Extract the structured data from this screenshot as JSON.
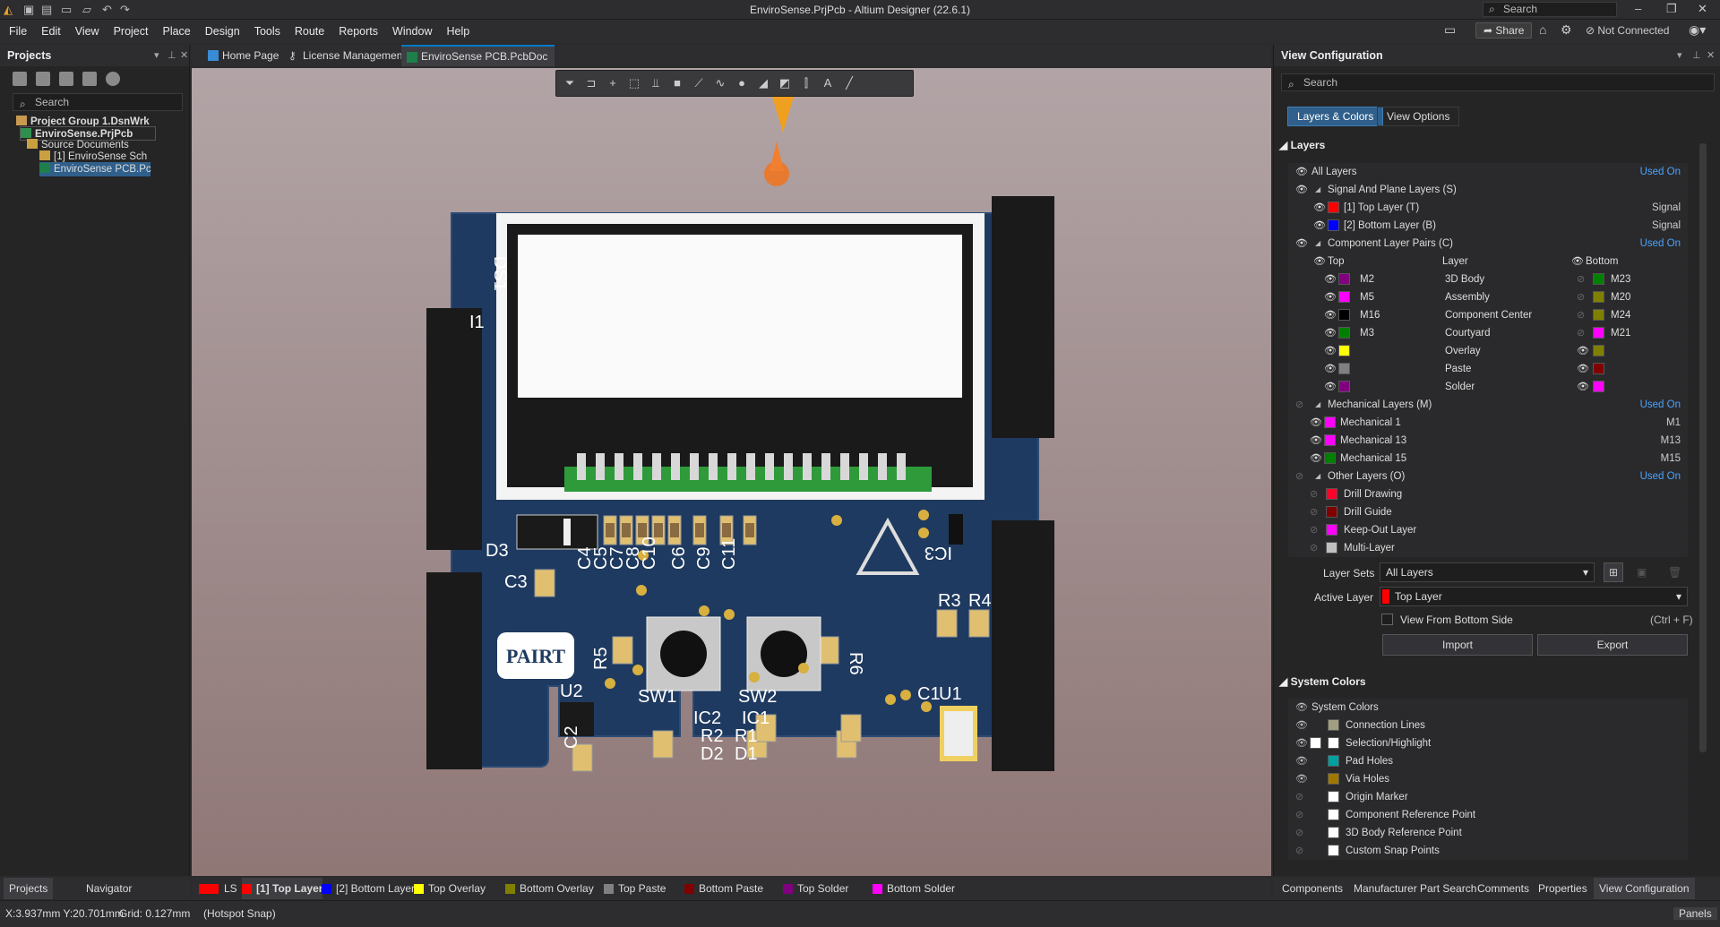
{
  "app": {
    "title": "EnviroSense.PrjPcb - Altium Designer (22.6.1)",
    "search_placeholder": "Search",
    "share_label": "Share",
    "connection_status": "Not Connected"
  },
  "menu": [
    "File",
    "Edit",
    "View",
    "Project",
    "Place",
    "Design",
    "Tools",
    "Route",
    "Reports",
    "Window",
    "Help"
  ],
  "projects_panel": {
    "title": "Projects",
    "search_placeholder": "Search",
    "tree": [
      {
        "label": "Project Group 1.DsnWrk",
        "level": 0
      },
      {
        "label": "EnviroSense.PrjPcb",
        "level": 1
      },
      {
        "label": "Source Documents",
        "level": 2
      },
      {
        "label": "[1] EnviroSense Sch",
        "level": 3
      },
      {
        "label": "EnviroSense PCB.Pc",
        "level": 3
      }
    ],
    "bottom_tabs": [
      "Projects",
      "Navigator"
    ]
  },
  "doc_tabs": [
    "Home Page",
    "License Management",
    "EnviroSense PCB.PcbDoc"
  ],
  "pcb": {
    "designators": [
      "DS1",
      "I1",
      "D3",
      "C3",
      "C4",
      "C5",
      "C7",
      "C8",
      "C10",
      "C6",
      "C9",
      "C11",
      "IC3",
      "R3",
      "R4",
      "R5",
      "SW1",
      "SW2",
      "R6",
      "U2",
      "IC2",
      "IC1",
      "C1",
      "U1",
      "R2",
      "R1",
      "D2",
      "D1",
      "C2"
    ],
    "logo_text": "PAIRT"
  },
  "view_config": {
    "title": "View Configuration",
    "search_placeholder": "Search",
    "tabs": [
      "Layers & Colors",
      "View Options"
    ],
    "layers_header": "Layers",
    "used_on": "Used On",
    "all_layers": "All Layers",
    "signal_group": "Signal And Plane Layers (S)",
    "signal_layers": [
      {
        "name": "[1] Top Layer (T)",
        "type": "Signal",
        "color": "#ff0000"
      },
      {
        "name": "[2] Bottom Layer (B)",
        "type": "Signal",
        "color": "#0000ff"
      }
    ],
    "component_group": "Component Layer Pairs (C)",
    "pair_headers": {
      "top": "Top",
      "layer": "Layer",
      "bottom": "Bottom"
    },
    "component_pairs": [
      {
        "top": "M2",
        "layer": "3D Body",
        "bottom": "M23",
        "top_color": "#800080",
        "bottom_color": "#008000"
      },
      {
        "top": "M5",
        "layer": "Assembly",
        "bottom": "M20",
        "top_color": "#ff00ff",
        "bottom_color": "#808000"
      },
      {
        "top": "M16",
        "layer": "Component Center",
        "bottom": "M24",
        "top_color": "#000000",
        "bottom_color": "#808000"
      },
      {
        "top": "M3",
        "layer": "Courtyard",
        "bottom": "M21",
        "top_color": "#008000",
        "bottom_color": "#ff00ff"
      },
      {
        "top": "",
        "layer": "Overlay",
        "bottom": "",
        "top_color": "#ffff00",
        "bottom_color": "#808000"
      },
      {
        "top": "",
        "layer": "Paste",
        "bottom": "",
        "top_color": "#808080",
        "bottom_color": "#800000"
      },
      {
        "top": "",
        "layer": "Solder",
        "bottom": "",
        "top_color": "#800080",
        "bottom_color": "#ff00ff"
      }
    ],
    "mechanical_group": "Mechanical Layers (M)",
    "mechanical_layers": [
      {
        "name": "Mechanical 1",
        "code": "M1",
        "color": "#ff00ff"
      },
      {
        "name": "Mechanical 13",
        "code": "M13",
        "color": "#ff00ff"
      },
      {
        "name": "Mechanical 15",
        "code": "M15",
        "color": "#008000"
      }
    ],
    "other_group": "Other Layers (O)",
    "other_layers": [
      {
        "name": "Drill Drawing",
        "color": "#ff002a"
      },
      {
        "name": "Drill Guide",
        "color": "#800000"
      },
      {
        "name": "Keep-Out Layer",
        "color": "#ff00ff"
      },
      {
        "name": "Multi-Layer",
        "color": "#c0c0c0"
      }
    ],
    "layer_sets_label": "Layer Sets",
    "layer_sets_value": "All Layers",
    "active_layer_label": "Active Layer",
    "active_layer_value": "Top Layer",
    "view_from_bottom": "View From Bottom Side",
    "view_from_bottom_shortcut": "(Ctrl + F)",
    "import_label": "Import",
    "export_label": "Export",
    "system_colors_header": "System Colors",
    "system_colors_title": "System Colors",
    "system_colors": [
      {
        "name": "Connection Lines",
        "color": "#a0a080"
      },
      {
        "name": "Selection/Highlight",
        "color": "#ffffff"
      },
      {
        "name": "Pad Holes",
        "color": "#00a0a0"
      },
      {
        "name": "Via Holes",
        "color": "#a07800"
      },
      {
        "name": "Origin Marker",
        "color": "#ffffff"
      },
      {
        "name": "Component Reference Point",
        "color": "#ffffff"
      },
      {
        "name": "3D Body Reference Point",
        "color": "#ffffff"
      },
      {
        "name": "Custom Snap Points",
        "color": "#ffffff"
      }
    ],
    "bottom_tabs": [
      "Components",
      "Manufacturer Part Search",
      "Comments",
      "Properties",
      "View Configuration"
    ]
  },
  "layer_tabs": [
    {
      "label": "LS",
      "color": "#ff0000"
    },
    {
      "label": "[1] Top Layer",
      "color": "#ff0000"
    },
    {
      "label": "[2] Bottom Layer",
      "color": "#0000ff"
    },
    {
      "label": "Top Overlay",
      "color": "#ffff00"
    },
    {
      "label": "Bottom Overlay",
      "color": "#808000"
    },
    {
      "label": "Top Paste",
      "color": "#808080"
    },
    {
      "label": "Bottom Paste",
      "color": "#800000"
    },
    {
      "label": "Top Solder",
      "color": "#800080"
    },
    {
      "label": "Bottom Solder",
      "color": "#ff00ff"
    }
  ],
  "status": {
    "coords": "X:3.937mm Y:20.701mm",
    "grid": "Grid: 0.127mm",
    "snap": "(Hotspot Snap)",
    "panels": "Panels"
  }
}
